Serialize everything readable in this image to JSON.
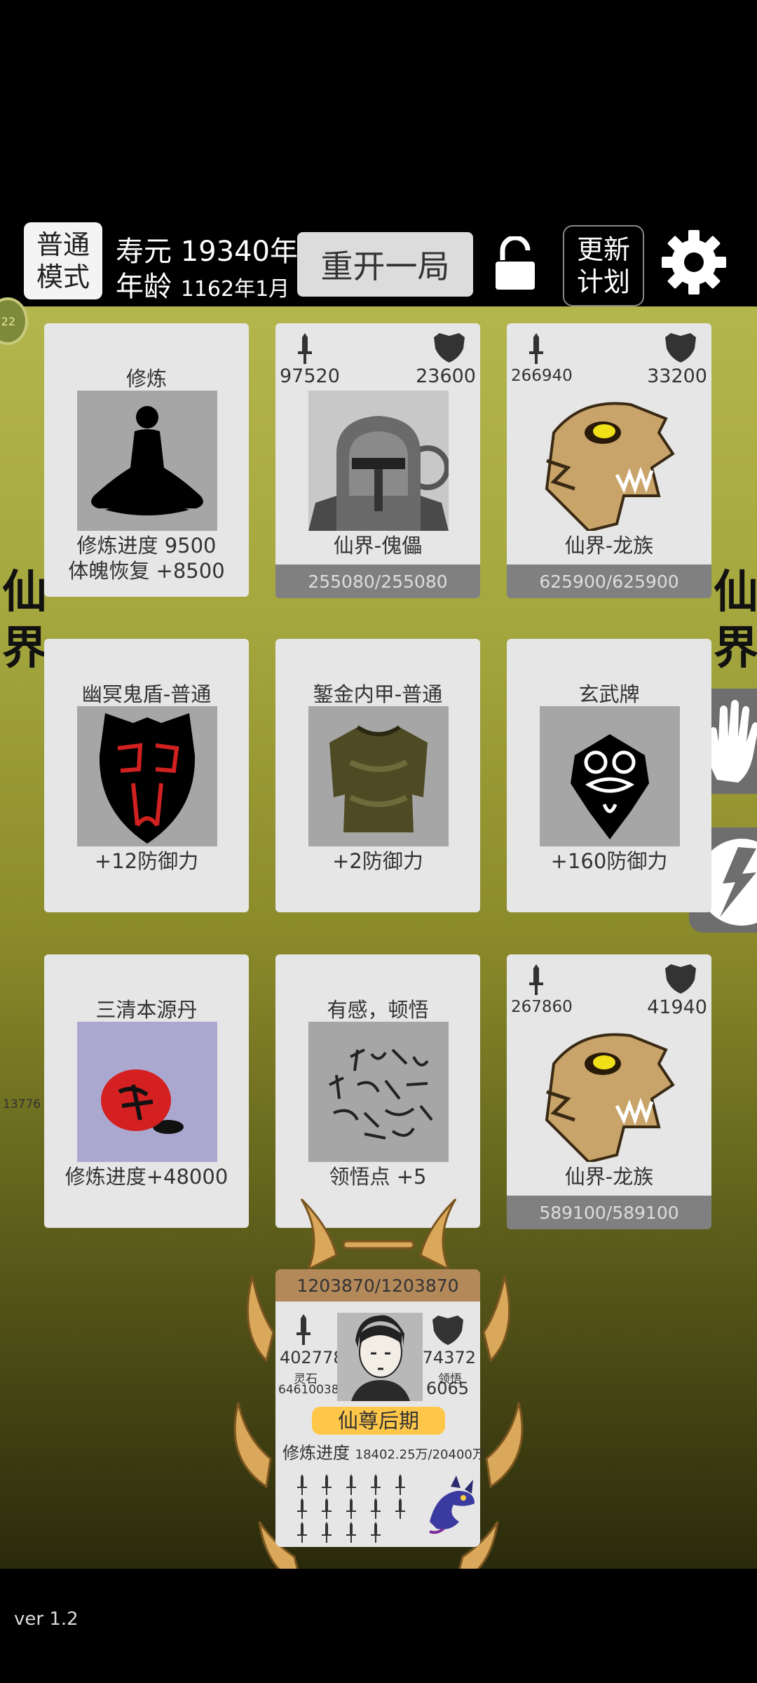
{
  "header": {
    "mode_label_line1": "普通",
    "mode_label_line2": "模式",
    "lifespan_label": "寿元",
    "lifespan_value": "19340年",
    "age_label": "年龄",
    "age_value": "1162年1月",
    "restart_label": "重开一局",
    "update_line1": "更新",
    "update_line2": "计划"
  },
  "side": {
    "left_label": [
      "仙",
      "界"
    ],
    "right_label": [
      "仙",
      "界"
    ],
    "left_small_number": "13776",
    "left_badge": "22"
  },
  "cards": [
    {
      "title": "修炼",
      "desc1": "修炼进度  9500",
      "desc2": "体魄恢复  +8500",
      "icon": "meditation-silhouette"
    },
    {
      "title": "仙界-傀儡",
      "attack": "97520",
      "defense": "23600",
      "hp": "255080/255080",
      "icon": "iron-helmet-knight"
    },
    {
      "title": "仙界-龙族",
      "attack": "266940",
      "defense": "33200",
      "hp": "625900/625900",
      "icon": "bone-dragon-skull"
    },
    {
      "title": "幽冥鬼盾-普通",
      "desc1": "+12防御力",
      "icon": "ghost-shield"
    },
    {
      "title": "錾金内甲-普通",
      "desc1": "+2防御力",
      "icon": "inner-armor-shirt"
    },
    {
      "title": "玄武牌",
      "desc1": "+160防御力",
      "icon": "xuanwu-token"
    },
    {
      "title": "三清本源丹",
      "desc1": "修炼进度+48000",
      "icon": "red-pill"
    },
    {
      "title": "有感，顿悟",
      "desc1": "领悟点  +5",
      "icon": "enlightenment-scroll"
    },
    {
      "title": "仙界-龙族",
      "attack": "267860",
      "defense": "41940",
      "hp": "589100/589100",
      "icon": "bone-dragon-skull"
    }
  ],
  "player": {
    "hp": "1203870/1203870",
    "attack": "402778",
    "defense": "274372",
    "spirit_stone_label": "灵石",
    "spirit_stone_value": "64610038",
    "insight_label": "领悟",
    "insight_value": "6065",
    "rank": "仙尊后期",
    "progress_label": "修炼进度",
    "progress_value": "18402.25万/20400万",
    "sword_count": 14
  },
  "footer": {
    "version": "ver 1.2"
  },
  "colors": {
    "board_top": "#b3b64c",
    "card_bg": "#e6e6e6",
    "hp_bar": "#808080",
    "rank_badge": "#ffc74a",
    "player_hp": "#b3895a"
  }
}
